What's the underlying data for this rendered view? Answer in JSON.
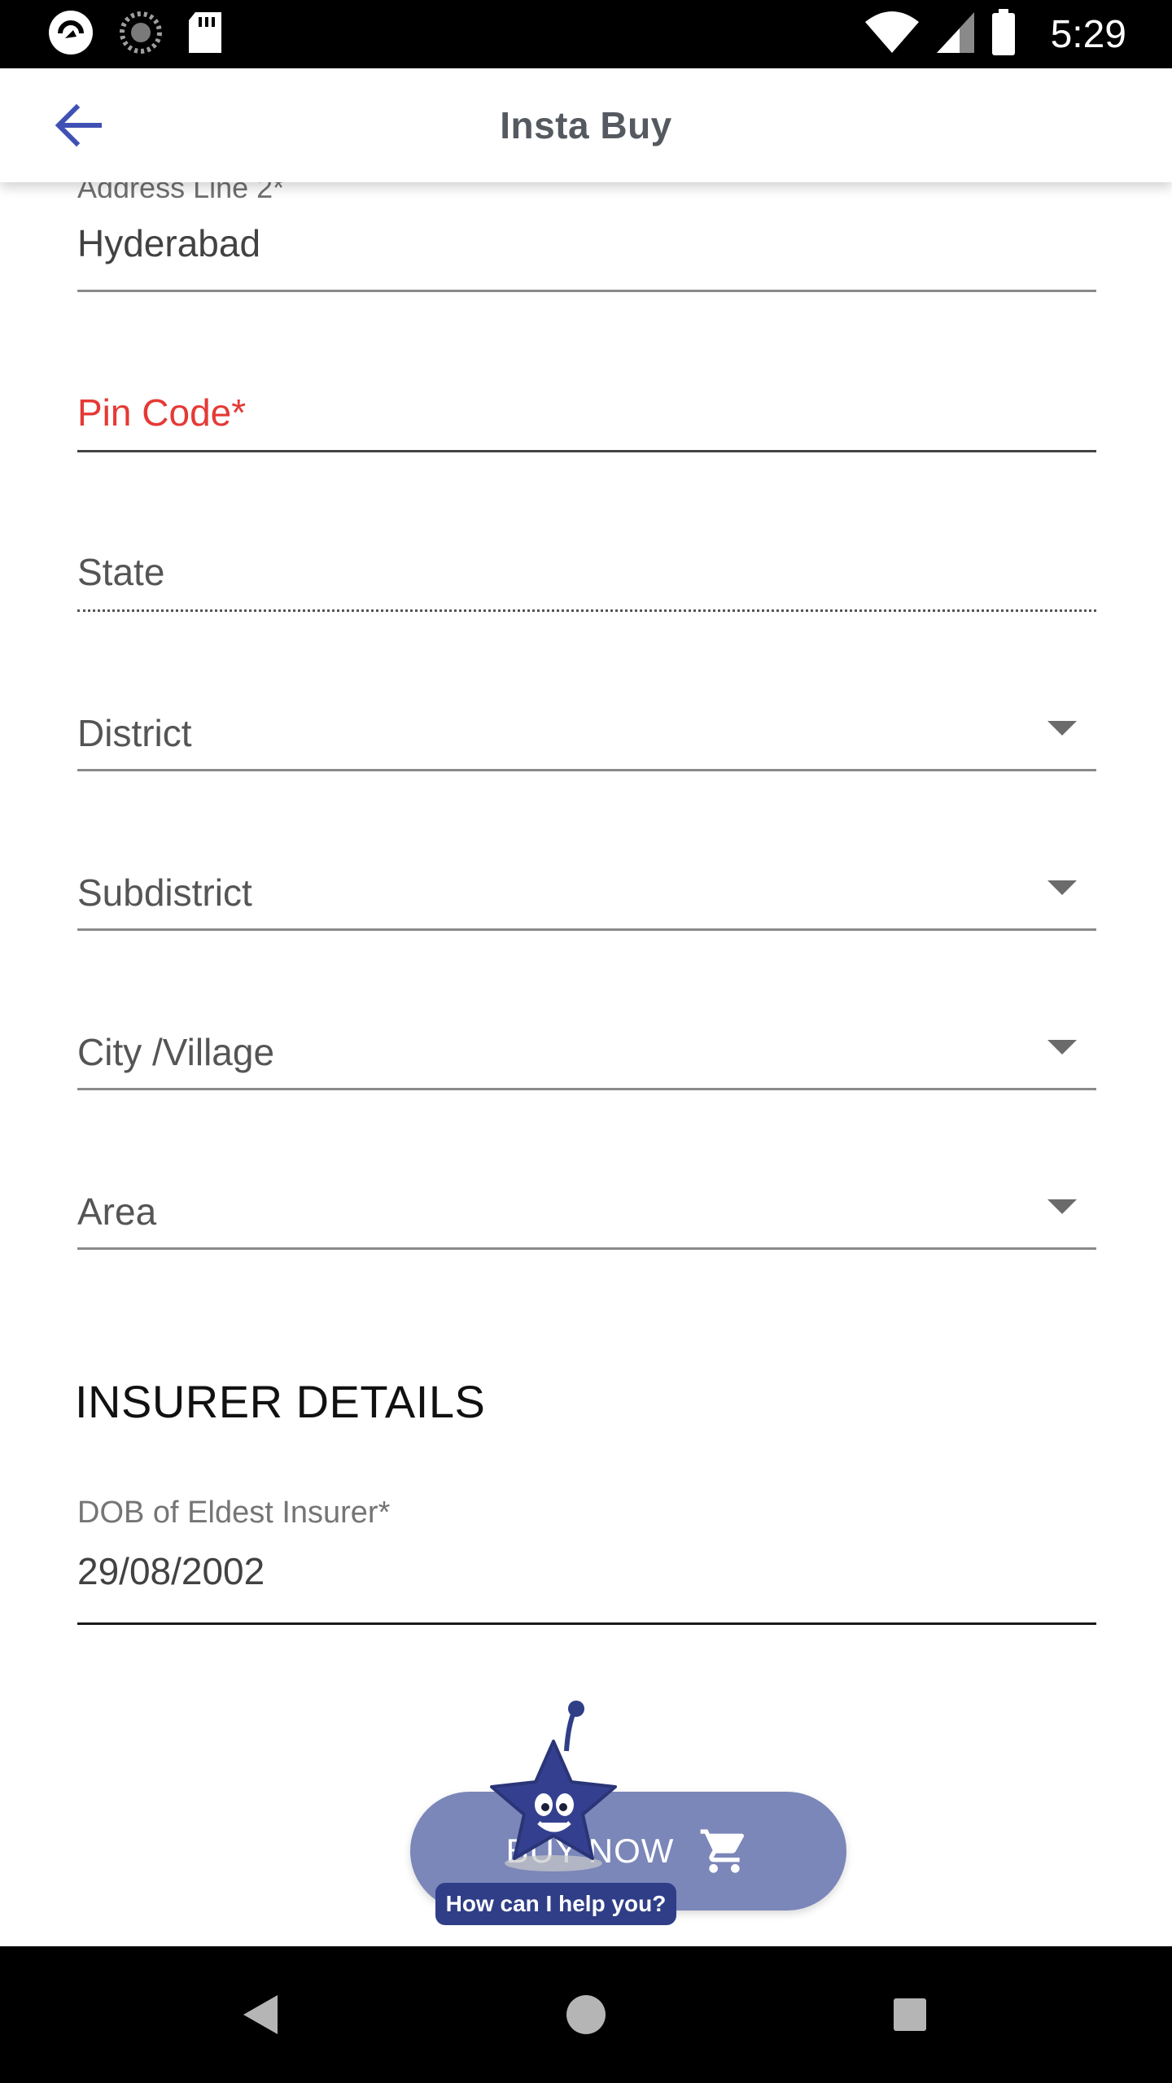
{
  "status_bar": {
    "time": "5:29",
    "icons": [
      "app-icon",
      "loading-icon",
      "sd-card-icon",
      "wifi-icon",
      "signal-icon",
      "battery-icon"
    ]
  },
  "app_bar": {
    "title": "Insta Buy",
    "back_icon": "arrow-left-icon",
    "accent_color": "#3f51b5"
  },
  "form": {
    "address_line2": {
      "label": "Address Line 2*",
      "value": "Hyderabad"
    },
    "pin_code": {
      "label": "Pin Code*",
      "error_color": "#e53935"
    },
    "state": {
      "label": "State"
    },
    "district": {
      "label": "District"
    },
    "subdistrict": {
      "label": "Subdistrict"
    },
    "city_village": {
      "label": "City /Village"
    },
    "area": {
      "label": "Area"
    }
  },
  "insurer_details": {
    "title": "INSURER DETAILS",
    "dob": {
      "label": "DOB of Eldest Insurer*",
      "value": "29/08/2002"
    }
  },
  "buy_now": {
    "label": "BUY NOW",
    "icon": "cart-icon",
    "color": "#7b86b9"
  },
  "chatbot": {
    "bubble_text": "How can I help you?",
    "color": "#2f3e87"
  },
  "nav_bar": {
    "buttons": [
      "back-triangle-icon",
      "home-circle-icon",
      "recents-square-icon"
    ]
  }
}
